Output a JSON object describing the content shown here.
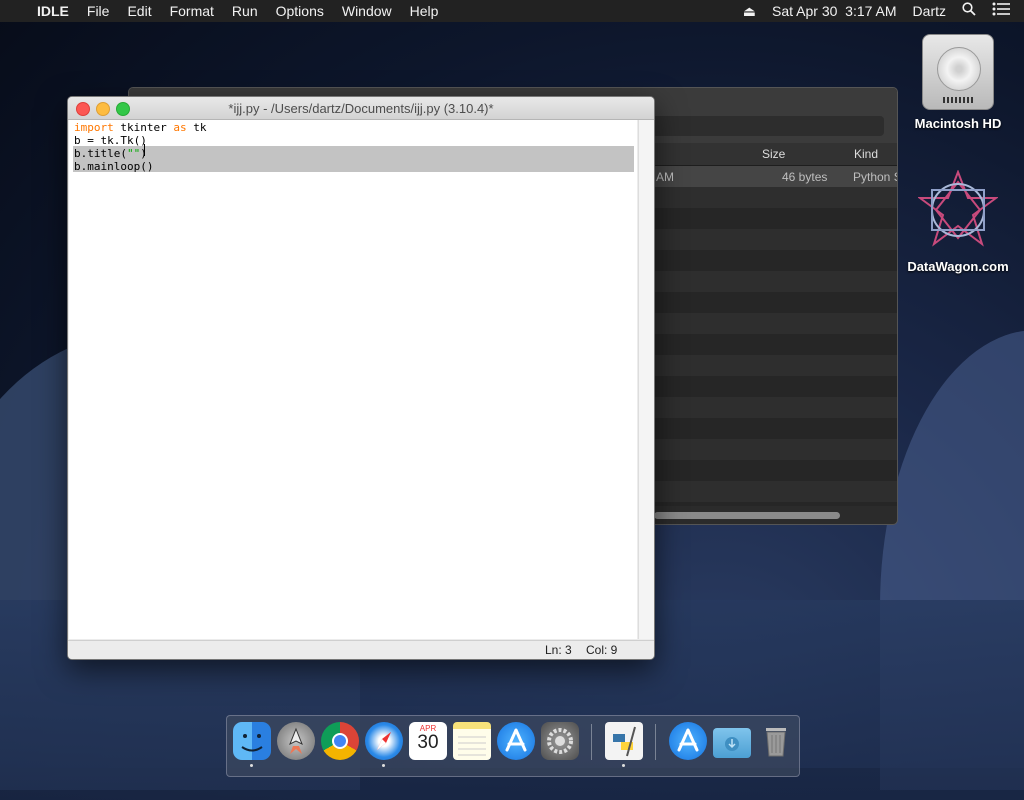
{
  "menubar": {
    "app": "IDLE",
    "items": [
      "File",
      "Edit",
      "Format",
      "Run",
      "Options",
      "Window",
      "Help"
    ],
    "clock": "Sat Apr 30  3:17 AM",
    "user": "Dartz"
  },
  "desktop": {
    "icons": [
      {
        "label": "Macintosh HD"
      },
      {
        "label": "DataWagon.com"
      }
    ]
  },
  "finder": {
    "columns": {
      "size": "Size",
      "kind": "Kind"
    },
    "row": {
      "date_fragment": "AM",
      "size": "46 bytes",
      "kind": "Python S"
    }
  },
  "idle": {
    "title": "*ijj.py - /Users/dartz/Documents/ijj.py (3.10.4)*",
    "code": {
      "line1": {
        "kw1": "import",
        "mid": " tkinter ",
        "kw2": "as",
        "end": " tk"
      },
      "line2": "b = tk.Tk()",
      "line3": {
        "pre": "b.title(",
        "sel": "\"\"",
        "post": ")"
      },
      "line4": "b.mainloop()"
    },
    "status": {
      "ln": "Ln: 3",
      "col": "Col: 9"
    }
  },
  "dock": {
    "items": [
      "finder-icon",
      "launchpad-icon",
      "chrome-icon",
      "safari-icon",
      "calendar-icon",
      "notes-icon",
      "app-store-icon",
      "system-preferences-icon",
      "python-launcher-icon",
      "app-store-icon",
      "downloads-folder-icon",
      "trash-icon"
    ],
    "calendar": {
      "month": "APR",
      "day": "30"
    }
  }
}
